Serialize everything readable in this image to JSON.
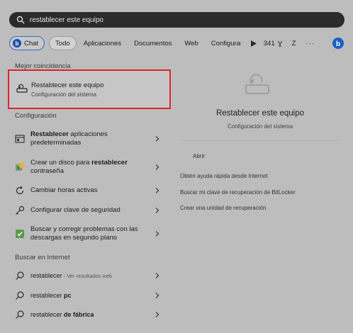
{
  "search": {
    "value": "restablecer este equipo"
  },
  "filters": {
    "chat": "Chat",
    "todo": "Todo",
    "apps": "Aplicaciones",
    "docs": "Documentos",
    "web": "Web",
    "config": "Configuraci",
    "points": "341",
    "user_initial": "Z",
    "more": "···"
  },
  "best_match": {
    "section_title": "Mejor coincidencia",
    "title": "Restablecer este equipo",
    "subtitle": "Configuración del sistema"
  },
  "settings_section": {
    "title": "Configuración",
    "items": [
      {
        "bold": "Restablecer",
        "text": " aplicaciones predeterminadas"
      },
      {
        "pre": "Crear un disco para ",
        "bold": "restablecer",
        "text": " contraseña"
      },
      {
        "text": "Cambiar horas activas"
      },
      {
        "text": "Configurar clave de seguridad"
      },
      {
        "text": "Buscar y corregir problemas con las descargas en segundo plano"
      }
    ]
  },
  "web_section": {
    "title": "Buscar en Internet",
    "items": [
      {
        "text": "restablecer",
        "suffix": " - Ver resultados web"
      },
      {
        "text": "restablecer ",
        "bold": "pc"
      },
      {
        "text": "restablecer ",
        "bold": "de fábrica"
      }
    ]
  },
  "preview": {
    "title": "Restablecer este equipo",
    "subtitle": "Configuración del sistema",
    "actions": [
      "Abrir",
      "Obtén ayuda rápida desde Internet",
      "Buscar mi clave de recuperación de BitLocker",
      "Crear una unidad de recuperación"
    ]
  }
}
